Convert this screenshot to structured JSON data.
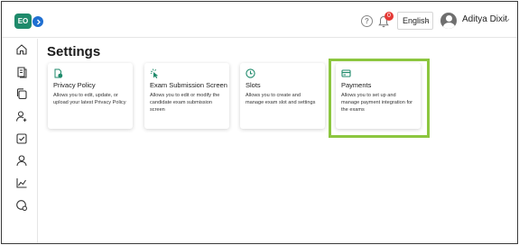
{
  "header": {
    "logo_text": "EO",
    "notification_count": "0",
    "language": "English",
    "user_name": "Aditya Dixit"
  },
  "sidebar": {
    "items": [
      {
        "icon": "home-icon"
      },
      {
        "icon": "book-icon"
      },
      {
        "icon": "copy-icon"
      },
      {
        "icon": "add-user-icon"
      },
      {
        "icon": "checklist-icon"
      },
      {
        "icon": "user-icon"
      },
      {
        "icon": "chart-icon"
      },
      {
        "icon": "settings-globe-icon"
      }
    ]
  },
  "main": {
    "title": "Settings",
    "cards": [
      {
        "title": "Privacy Policy",
        "description": "Allows you to edit, update, or upload your latest Privacy Policy",
        "icon": "document-shield-icon"
      },
      {
        "title": "Exam Submission Screen",
        "description": "Allows you to edit or modify the candidate exam submission screen",
        "icon": "cursor-click-icon"
      },
      {
        "title": "Slots",
        "description": "Allows you to create and manage exam slot and settings",
        "icon": "clock-icon"
      },
      {
        "title": "Payments",
        "description": "Allows you to set up and manage payment integration for the exams",
        "icon": "payment-card-icon"
      }
    ]
  },
  "colors": {
    "accent_green": "#1f8a6b",
    "expand_blue": "#1f6fd1",
    "highlight_border": "#8cc63f",
    "badge_red": "#e53935"
  }
}
